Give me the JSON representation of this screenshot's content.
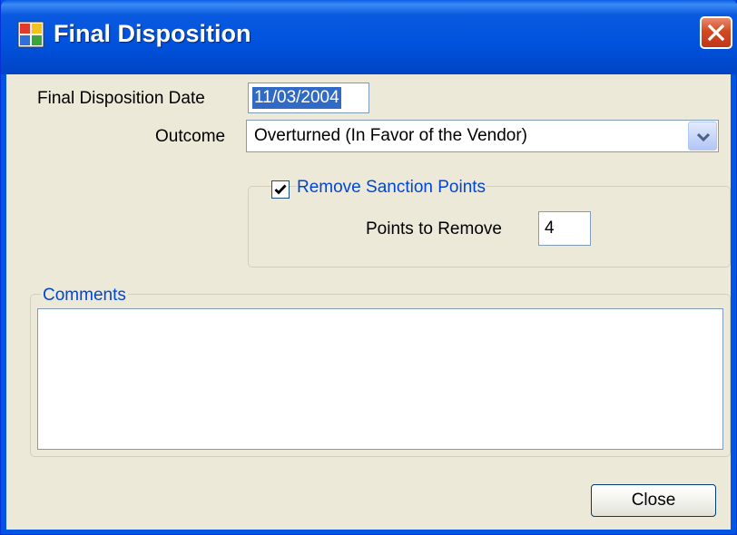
{
  "window": {
    "title": "Final Disposition",
    "icons": {
      "app": "app-form-icon",
      "close": "close-icon"
    }
  },
  "form": {
    "date_label": "Final Disposition Date",
    "date_value": "11/03/2004",
    "outcome_label": "Outcome",
    "outcome_value": "Overturned (In Favor of the Vendor)",
    "outcome_dropdown_icon": "chevron-down-icon",
    "remove_sanction_label": "Remove Sanction Points",
    "remove_sanction_checked": true,
    "points_label": "Points to Remove",
    "points_value": "4",
    "comments_label": "Comments",
    "comments_value": ""
  },
  "buttons": {
    "close_label": "Close"
  },
  "colors": {
    "titlebar": "#0055e5",
    "face": "#ece9d8",
    "group_label": "#0046d5",
    "selection": "#316ac5",
    "close_button": "#d24a23"
  }
}
